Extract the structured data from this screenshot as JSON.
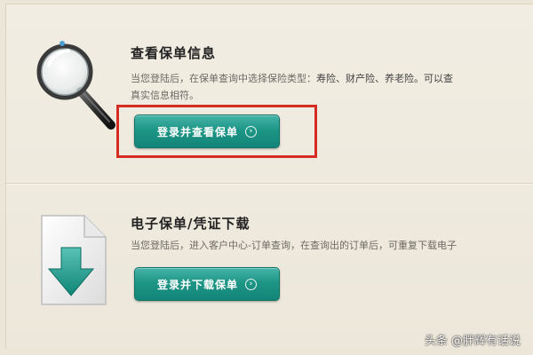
{
  "section_view": {
    "title": "查看保单信息",
    "description_line1_prefix": "当您登陆后，在保单查询中选择保险类型：",
    "description_line1_types": "寿险、财产险、养老险。可以查",
    "description_line2": "真实信息相符。",
    "button_label": "登录并查看保单",
    "button_icon": "circle-arrow-right"
  },
  "section_download": {
    "title": "电子保单/凭证下载",
    "description": "当您登陆后，进入客户中心-订单查询，在查询出的订单后，可重复下载电子",
    "button_label": "登录并下载保单",
    "button_icon": "circle-arrow-right"
  },
  "highlight_color": "#d42b22",
  "button_color": "#1e9686",
  "watermark": "头条 @胖辉有话说"
}
